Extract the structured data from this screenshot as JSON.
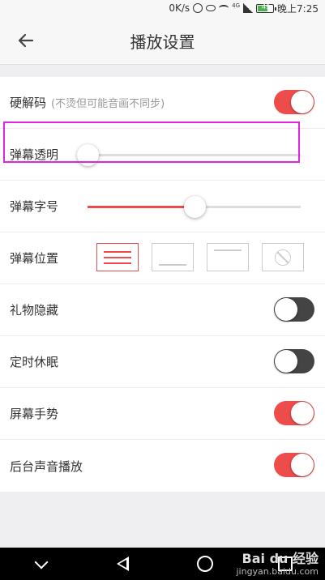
{
  "status_bar": {
    "net_speed": "0K/s",
    "signal_label": "4G",
    "battery": "49",
    "time": "晚上7:25"
  },
  "header": {
    "title": "播放设置"
  },
  "settings": {
    "hw_decode": {
      "label": "硬解码",
      "hint": "(不烫但可能音画不同步)",
      "enabled": true
    },
    "danmaku_opacity": {
      "label": "弹幕透明",
      "value": 0
    },
    "danmaku_font_size": {
      "label": "弹幕字号",
      "value": 0.5
    },
    "danmaku_position": {
      "label": "弹幕位置",
      "options": [
        "full",
        "bottom",
        "top",
        "off"
      ],
      "selected": "full"
    },
    "gift_hide": {
      "label": "礼物隐藏",
      "enabled": false
    },
    "sleep_timer": {
      "label": "定时休眠",
      "enabled": false
    },
    "screen_gesture": {
      "label": "屏幕手势",
      "enabled": true
    },
    "background_audio": {
      "label": "后台声音播放",
      "enabled": true
    }
  },
  "colors": {
    "accent": "#ee4b4b",
    "toggle_off": "#444444",
    "highlight": "#e026e0"
  },
  "watermark": {
    "brand": "Bai du 经验",
    "url": "jingyan.baidu.com"
  }
}
